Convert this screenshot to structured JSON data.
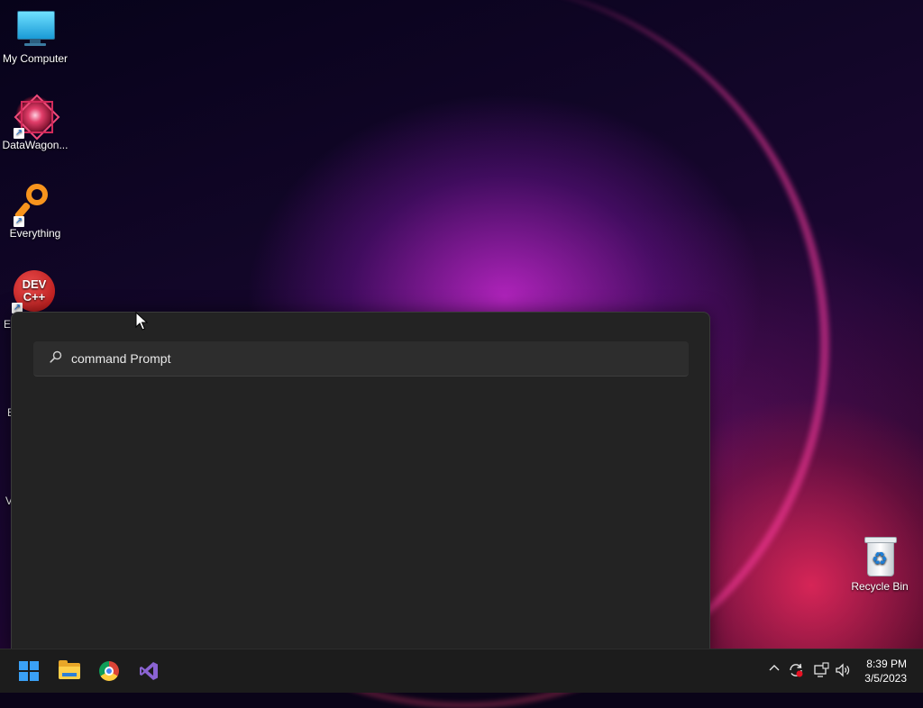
{
  "desktop": {
    "icons": [
      {
        "label": "My Computer"
      },
      {
        "label": "DataWagon..."
      },
      {
        "label": "Everything"
      },
      {
        "label": "DEV\nC++"
      },
      {
        "label": "Recycle Bin"
      }
    ],
    "partial_labels": [
      "Er",
      "E",
      "V"
    ]
  },
  "start_menu": {
    "search": {
      "value": "command Prompt",
      "icon": "search-icon"
    }
  },
  "taskbar": {
    "apps": [
      {
        "icon": "windows-start-icon"
      },
      {
        "icon": "file-explorer-icon"
      },
      {
        "icon": "chrome-icon"
      },
      {
        "icon": "visual-studio-icon"
      }
    ],
    "tray": {
      "icons": [
        "chevron-up-icon",
        "sync-icon",
        "network-icon",
        "volume-icon"
      ]
    },
    "clock": {
      "time": "8:39 PM",
      "date": "3/5/2023"
    }
  },
  "colors": {
    "accent": "#3aa0f5",
    "panel": "#232323",
    "taskbar": "#1c1c1c"
  }
}
